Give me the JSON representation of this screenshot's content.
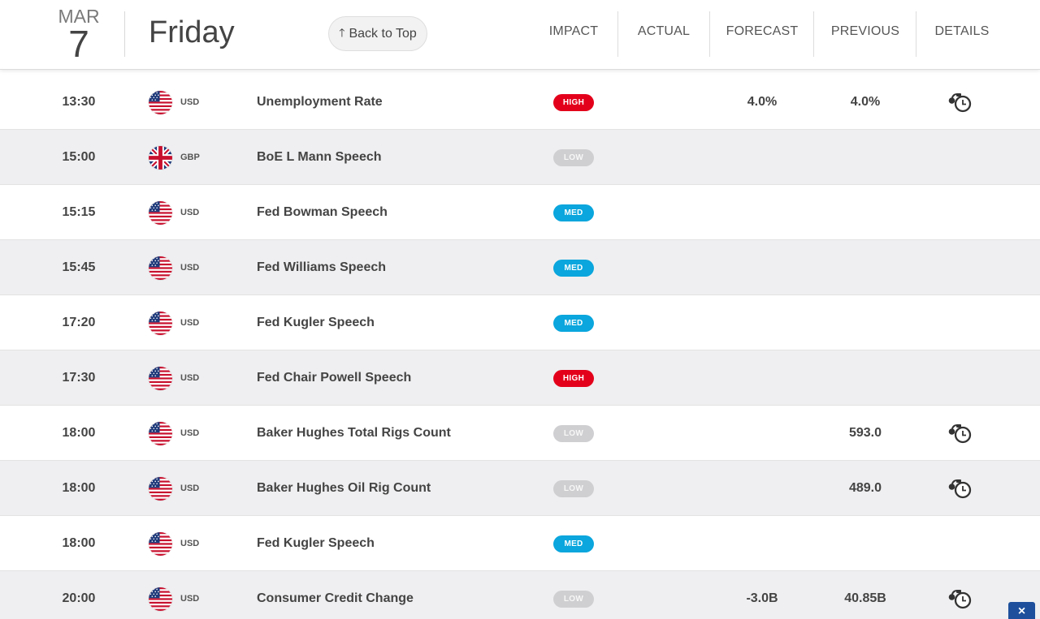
{
  "header": {
    "month": "MAR",
    "day": "7",
    "weekday": "Friday",
    "back_to_top": "Back to Top",
    "columns": {
      "impact": "IMPACT",
      "actual": "ACTUAL",
      "forecast": "FORECAST",
      "previous": "PREVIOUS",
      "details": "DETAILS"
    }
  },
  "colors": {
    "high": "#e3001b",
    "med": "#0aa6dd",
    "low": "#cfcfd2",
    "row_alt": "#efeff1"
  },
  "events": [
    {
      "time": "13:30",
      "currency": "USD",
      "flag": "us-flag-icon",
      "event": "Unemployment Rate",
      "impact": "HIGH",
      "actual": "",
      "forecast": "4.0%",
      "previous": "4.0%",
      "details": true
    },
    {
      "time": "15:00",
      "currency": "GBP",
      "flag": "uk-flag-icon",
      "event": "BoE L Mann Speech",
      "impact": "LOW",
      "actual": "",
      "forecast": "",
      "previous": "",
      "details": false
    },
    {
      "time": "15:15",
      "currency": "USD",
      "flag": "us-flag-icon",
      "event": "Fed Bowman Speech",
      "impact": "MED",
      "actual": "",
      "forecast": "",
      "previous": "",
      "details": false
    },
    {
      "time": "15:45",
      "currency": "USD",
      "flag": "us-flag-icon",
      "event": "Fed Williams Speech",
      "impact": "MED",
      "actual": "",
      "forecast": "",
      "previous": "",
      "details": false
    },
    {
      "time": "17:20",
      "currency": "USD",
      "flag": "us-flag-icon",
      "event": "Fed Kugler Speech",
      "impact": "MED",
      "actual": "",
      "forecast": "",
      "previous": "",
      "details": false
    },
    {
      "time": "17:30",
      "currency": "USD",
      "flag": "us-flag-icon",
      "event": "Fed Chair Powell Speech",
      "impact": "HIGH",
      "actual": "",
      "forecast": "",
      "previous": "",
      "details": false
    },
    {
      "time": "18:00",
      "currency": "USD",
      "flag": "us-flag-icon",
      "event": "Baker Hughes Total Rigs Count",
      "impact": "LOW",
      "actual": "",
      "forecast": "",
      "previous": "593.0",
      "details": true
    },
    {
      "time": "18:00",
      "currency": "USD",
      "flag": "us-flag-icon",
      "event": "Baker Hughes Oil Rig Count",
      "impact": "LOW",
      "actual": "",
      "forecast": "",
      "previous": "489.0",
      "details": true
    },
    {
      "time": "18:00",
      "currency": "USD",
      "flag": "us-flag-icon",
      "event": "Fed Kugler Speech",
      "impact": "MED",
      "actual": "",
      "forecast": "",
      "previous": "",
      "details": false
    },
    {
      "time": "20:00",
      "currency": "USD",
      "flag": "us-flag-icon",
      "event": "Consumer Credit Change",
      "impact": "LOW",
      "actual": "",
      "forecast": "-3.0B",
      "previous": "40.85B",
      "details": true
    }
  ],
  "corner_close": "×"
}
